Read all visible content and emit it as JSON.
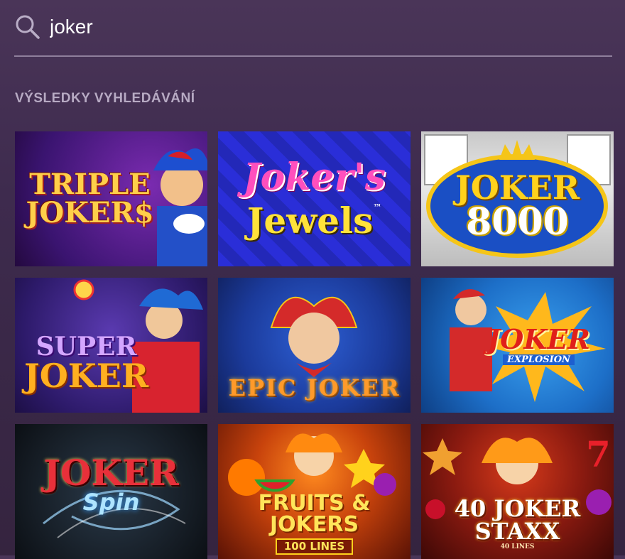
{
  "search": {
    "value": "joker",
    "icon": "search-icon"
  },
  "results": {
    "heading": "VÝSLEDKY VYHLEDÁVÁNÍ",
    "games": [
      {
        "id": "triple-jokers",
        "line1": "TRIPLE",
        "line2": "JOKER$",
        "line3": ""
      },
      {
        "id": "jokers-jewels",
        "line1": "Joker's",
        "line2": "Jewels",
        "line3": "™"
      },
      {
        "id": "joker-8000",
        "line1": "JOKER",
        "line2": "8000",
        "line3": ""
      },
      {
        "id": "super-joker",
        "line1": "SUPER",
        "line2": "JOKER",
        "line3": ""
      },
      {
        "id": "epic-joker",
        "line1": "EPIC JOKER",
        "line2": "",
        "line3": ""
      },
      {
        "id": "joker-explosion",
        "line1": "JOKER",
        "line2": "EXPLOSION",
        "line3": ""
      },
      {
        "id": "joker-spin",
        "line1": "JOKER",
        "line2": "Spin",
        "line3": ""
      },
      {
        "id": "fruits-and-jokers",
        "line1": "FRUITS & JOKERS",
        "line2": "100 LINES",
        "line3": ""
      },
      {
        "id": "40-joker-staxx",
        "line1": "40 JOKER",
        "line2": "STAXX",
        "line3": "40 LINES"
      }
    ]
  },
  "colors": {
    "background": "#3e2b4e",
    "heading": "#b7aac3",
    "divider": "#8f7f9c",
    "input_text": "#ffffff"
  }
}
